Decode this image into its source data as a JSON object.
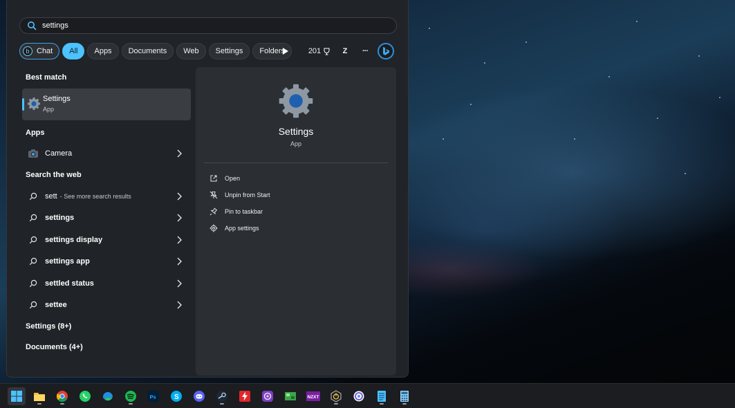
{
  "search": {
    "value": "settings",
    "icon": "search-icon"
  },
  "filters": {
    "chat_label": "Chat",
    "chips": [
      "All",
      "Apps",
      "Documents",
      "Web",
      "Settings",
      "Folders"
    ],
    "active": "All",
    "points": "201",
    "avatar_letter": "Z",
    "more_label": "···",
    "accent_color": "#4cc2ff"
  },
  "left": {
    "best_match_title": "Best match",
    "best_match": {
      "name": "Settings",
      "type": "App"
    },
    "apps_title": "Apps",
    "apps": [
      {
        "name": "Camera"
      }
    ],
    "web_title": "Search the web",
    "web": [
      {
        "query": "sett",
        "sub": "- See more search results"
      },
      {
        "query": "settings",
        "sub": ""
      },
      {
        "query": "settings display",
        "sub": ""
      },
      {
        "query": "settings app",
        "sub": ""
      },
      {
        "query": "settled status",
        "sub": ""
      },
      {
        "query": "settee",
        "sub": ""
      }
    ],
    "settings_more": "Settings (8+)",
    "documents_more": "Documents (4+)"
  },
  "detail": {
    "title": "Settings",
    "type": "App",
    "actions": [
      "Open",
      "Unpin from Start",
      "Pin to taskbar",
      "App settings"
    ]
  },
  "taskbar": {
    "apps": [
      "start",
      "file-explorer",
      "chrome",
      "whatsapp",
      "edge",
      "spotify",
      "photoshop",
      "skype",
      "discord",
      "steam",
      "flash",
      "app-purple",
      "maps",
      "nzxt",
      "app-power",
      "app-ring",
      "notepad",
      "calculator"
    ]
  }
}
